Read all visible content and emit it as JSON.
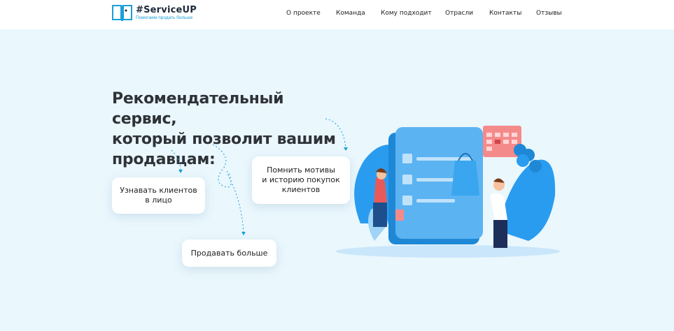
{
  "header": {
    "logo_title": "#ServiceUP",
    "logo_subtitle": "Помогаем продать больше",
    "nav": [
      "О проекте",
      "Команда",
      "Кому подходит",
      "Отрасли",
      "Контакты",
      "Отзывы"
    ]
  },
  "hero": {
    "title_lines": [
      "Рекомендательный сервис,",
      "который позволит вашим",
      "продавцам:"
    ],
    "cards": {
      "recognize": "Узнавать клиентов\nв лицо",
      "sell_more": "Продавать больше",
      "remember": "Помнить мотивы\nи историю покупок\nклиентов"
    }
  },
  "colors": {
    "background": "#eaf7fd",
    "accent": "#1aa0d8",
    "primary_blue": "#1e88d6",
    "dark_text": "#2f3338"
  }
}
